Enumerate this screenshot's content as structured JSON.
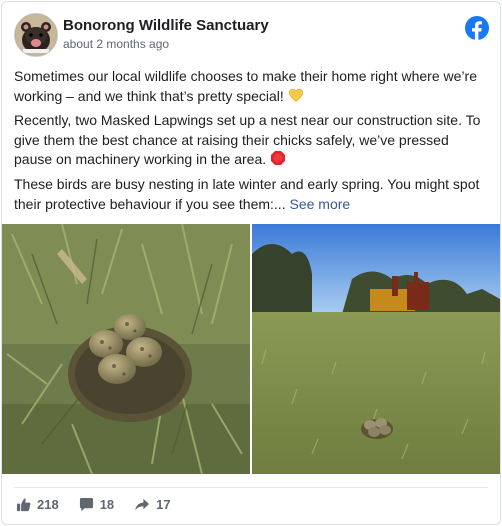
{
  "post": {
    "page_name": "Bonorong Wildlife Sanctuary",
    "timestamp": "about 2 months ago",
    "paragraph1": "Sometimes our local wildlife chooses to make their home right where we’re working – and we think that’s pretty special! ",
    "paragraph2": "Recently, two Masked Lapwings set up a nest near our construction site. To give them the best chance at raising their chicks safely, we’ve pressed pause on machinery working in the area. ",
    "paragraph3": "These birds are busy nesting in late winter and early spring. You might spot their protective behaviour if you see them:... ",
    "see_more": "See more",
    "emoji1": "yellow-heart-icon",
    "emoji2": "stop-sign-icon"
  },
  "photos": [
    {
      "subject": "lapwing-nest-eggs-closeup"
    },
    {
      "subject": "nest-in-field-with-construction-machinery"
    }
  ],
  "actions": {
    "likes": "218",
    "comments": "18",
    "shares": "17"
  },
  "colors": {
    "brand_blue": "#1877f2",
    "link": "#385898",
    "muted": "#606770"
  }
}
